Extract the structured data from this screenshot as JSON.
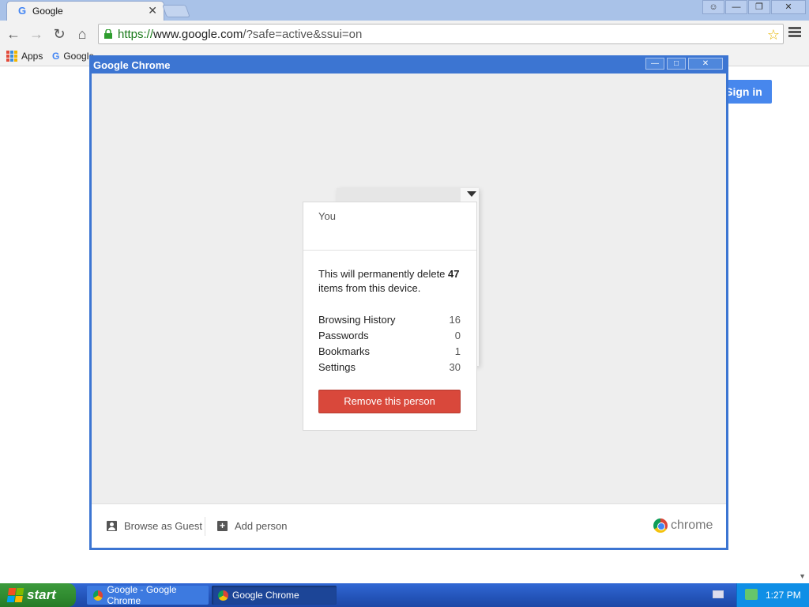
{
  "browser": {
    "tab_title": "Google",
    "tab_favicon": "G",
    "tab_close": "✕",
    "url_scheme": "https://",
    "url_host": "www.google.com",
    "url_rest": "/?safe=active&ssui=on",
    "bookmarks": [
      {
        "label": "Apps"
      },
      {
        "label": "Google"
      }
    ]
  },
  "page": {
    "sign_in": "Sign in"
  },
  "user_manager": {
    "window_title": "Google Chrome",
    "profile_name": "You",
    "message_prefix": "This will permanently delete ",
    "message_count": "47",
    "message_suffix": "items from this device.",
    "stats": [
      {
        "label": "Browsing History",
        "value": "16"
      },
      {
        "label": "Passwords",
        "value": "0"
      },
      {
        "label": "Bookmarks",
        "value": "1"
      },
      {
        "label": "Settings",
        "value": "30"
      }
    ],
    "remove_button": "Remove this person",
    "browse_as_guest": "Browse as Guest",
    "add_person": "Add person",
    "chrome_word": "chrome"
  },
  "taskbar": {
    "start_label": "start",
    "tasks": [
      {
        "label": "Google - Google Chrome"
      },
      {
        "label": "Google Chrome"
      }
    ],
    "clock": "1:27 PM"
  },
  "colors": {
    "window_blue": "#3c75d2",
    "remove_red": "#d9483b",
    "signin_blue": "#4787ed",
    "url_green": "#1a7a1a"
  }
}
